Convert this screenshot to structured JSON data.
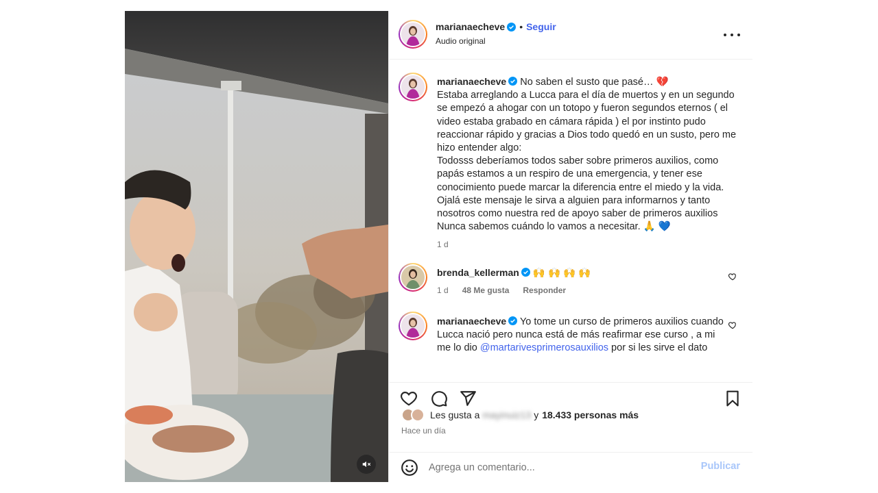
{
  "post": {
    "author": "marianaecheve",
    "follow_label": "Seguir",
    "separator": "•",
    "audio_label": "Audio original",
    "more_icon": "more-options-icon"
  },
  "caption": {
    "username": "marianaecheve",
    "text": "No saben el susto que pasé… 💔\nEstaba arreglando a Lucca para el día de muertos y en un segundo se empezó a ahogar con un totopo y fueron segundos eternos ( el video estaba grabado en cámara rápida ) el por instinto pudo reaccionar rápido y gracias a Dios todo quedó en un susto, pero me hizo entender algo:\nTodosss deberíamos todos saber sobre primeros auxilios, como papás estamos a un respiro de una emergencia, y tener ese conocimiento puede marcar la diferencia entre el miedo y la vida.\nOjalá este mensaje le sirva a alguien para informarnos y tanto nosotros como nuestra red de apoyo saber de primeros auxilios\nNunca sabemos cuándo lo vamos a necesitar. 🙏 💙",
    "age": "1 d"
  },
  "comments": [
    {
      "username": "brenda_kellerman",
      "text": "🙌 🙌 🙌 🙌",
      "age": "1 d",
      "likes": "48 Me gusta",
      "reply_label": "Responder"
    },
    {
      "username": "marianaecheve",
      "text_before": "Yo tome un curso de primeros auxilios cuando Lucca nació pero nunca está de más reafirmar ese curso , a mi me lo dio ",
      "mention": "@martarivesprimerosauxilios",
      "text_after": " por si les sirve el dato"
    }
  ],
  "likes": {
    "prefix": "Les gusta a",
    "blurred_user": "mayinuiz13",
    "connector": "y",
    "count_text": "18.433 personas más"
  },
  "timestamp": "Hace un día",
  "composer": {
    "placeholder": "Agrega un comentario...",
    "publish_label": "Publicar"
  },
  "colors": {
    "accent": "#4263eb",
    "publish_disabled": "#a8c6fa",
    "text": "#262626",
    "muted": "#737373"
  }
}
